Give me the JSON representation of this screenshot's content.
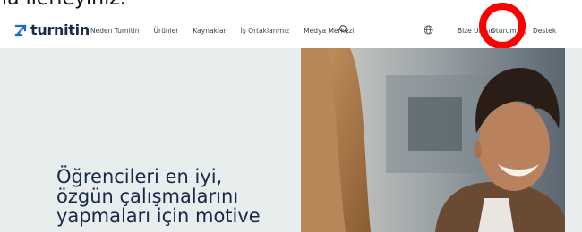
{
  "top_strip_text": "la ilerleyiniz.",
  "brand": {
    "name": "turnitin",
    "color": "#1b6cc9"
  },
  "nav": {
    "links": [
      "Neden Turnitin",
      "Ürünler",
      "Kaynaklar",
      "İş Ortaklarımız",
      "Medya Merkezi"
    ],
    "search_icon": "search-icon"
  },
  "right_nav": {
    "globe_icon": "globe-icon",
    "contact": "Bize Ulaşın",
    "login": "Oturum Aç",
    "support": "Destek"
  },
  "annotation": {
    "color": "#ff0000"
  },
  "hero": {
    "lines": [
      "Öğrencileri en iyi,",
      "özgün çalışmalarını",
      "yapmaları için motive"
    ],
    "background": "#e8eeed",
    "text_color": "#182848"
  }
}
